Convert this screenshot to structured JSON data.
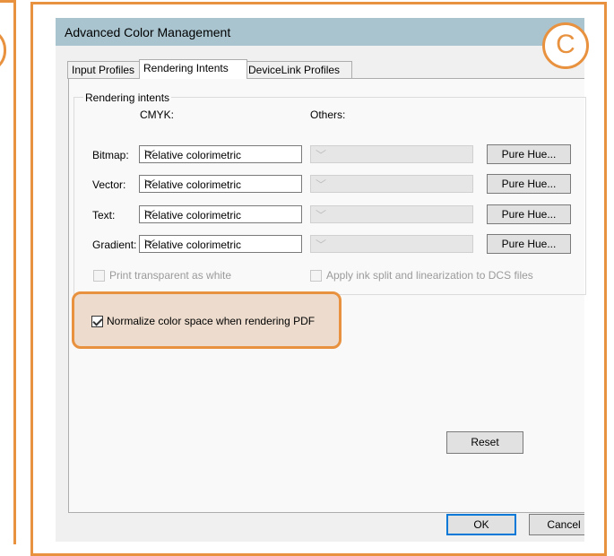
{
  "window": {
    "title": "Advanced Color Management"
  },
  "badge": "C",
  "tabs": [
    {
      "label": "Input Profiles",
      "active": false
    },
    {
      "label": "Rendering Intents",
      "active": true
    },
    {
      "label": "DeviceLink Profiles",
      "active": false
    }
  ],
  "group": {
    "title": "Rendering intents",
    "col_cmyk": "CMYK:",
    "col_others": "Others:",
    "rows": [
      {
        "label": "Bitmap:",
        "cmyk": "Relative colorimetric",
        "others": "",
        "button": "Pure Hue..."
      },
      {
        "label": "Vector:",
        "cmyk": "Relative colorimetric",
        "others": "",
        "button": "Pure Hue..."
      },
      {
        "label": "Text:",
        "cmyk": "Relative colorimetric",
        "others": "",
        "button": "Pure Hue..."
      },
      {
        "label": "Gradient:",
        "cmyk": "Relative colorimetric",
        "others": "",
        "button": "Pure Hue..."
      }
    ],
    "print_transparent": {
      "label": "Print transparent as white",
      "checked": false,
      "enabled": false
    },
    "ink_split": {
      "label": "Apply ink split and linearization to DCS files",
      "checked": false,
      "enabled": false
    }
  },
  "normalize": {
    "label": "Normalize color space when rendering PDF",
    "checked": true
  },
  "buttons": {
    "reset": "Reset",
    "ok": "OK",
    "cancel": "Cancel"
  },
  "colors": {
    "accent": "#e8913e",
    "titlebar": "#a9c4cf",
    "highlight_fill": "#eddccd",
    "focus": "#0078d7"
  }
}
